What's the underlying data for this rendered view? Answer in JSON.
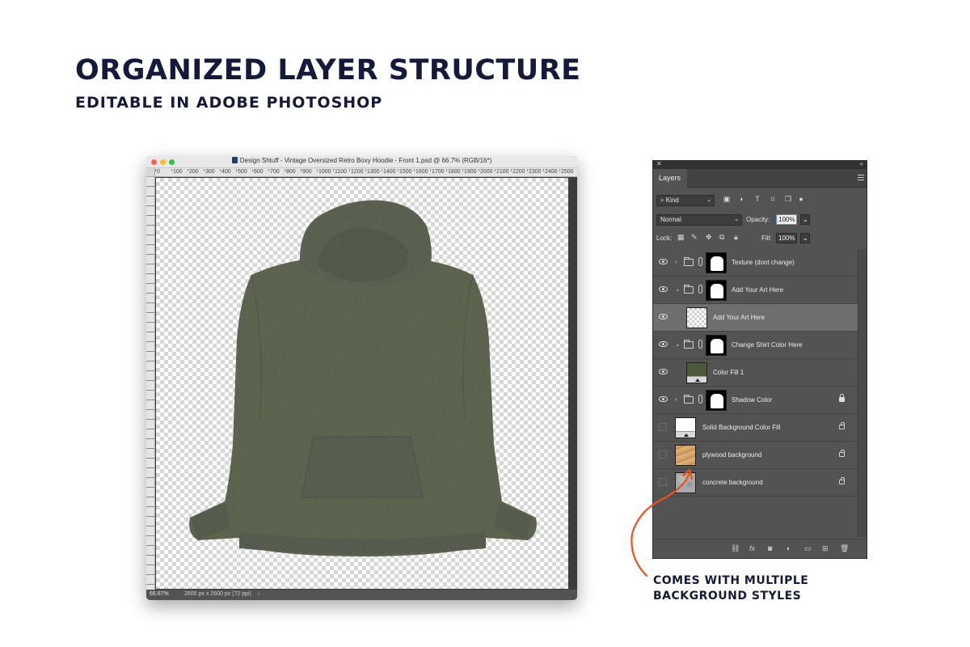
{
  "heading": {
    "title": "ORGANIZED LAYER STRUCTURE",
    "subtitle": "EDITABLE IN ADOBE PHOTOSHOP"
  },
  "document_window": {
    "title": "Design Shtuff - Vintage Oversized Retro Boxy Hoodie - Front 1.psd @ 66.7% (RGB/16*)",
    "ruler_labels": [
      "0",
      "100",
      "200",
      "300",
      "400",
      "500",
      "600",
      "700",
      "800",
      "900",
      "1000",
      "1100",
      "1200",
      "1300",
      "1400",
      "1500",
      "1600",
      "1700",
      "1800",
      "1900",
      "2000",
      "2100",
      "2200",
      "2300",
      "2400",
      "2500"
    ],
    "status_zoom": "66.67%",
    "status_dims": "2600 px x 2600 px (72 ppi)",
    "status_arrow": "›",
    "hoodie_color": "#4b5439"
  },
  "layers_panel": {
    "tab_label": "Layers",
    "filter_kind": "Kind",
    "blend_mode": "Normal",
    "opacity_label": "Opacity:",
    "opacity_value": "100%",
    "lock_label": "Lock:",
    "fill_label": "Fill:",
    "fill_value": "100%",
    "layers": [
      {
        "name": "Texture (dont change)",
        "type": "group",
        "visible": true,
        "expanded": false,
        "locked": false
      },
      {
        "name": "Add Your Art Here",
        "type": "group",
        "visible": true,
        "expanded": true,
        "locked": false
      },
      {
        "name": "Add Your Art Here",
        "type": "smart-object",
        "visible": true,
        "selected": true,
        "locked": false
      },
      {
        "name": "Change Shirt Color Here",
        "type": "group",
        "visible": true,
        "expanded": true,
        "locked": false
      },
      {
        "name": "Color Fill 1",
        "type": "fill",
        "visible": true,
        "locked": false
      },
      {
        "name": "Shadow Color",
        "type": "group",
        "visible": true,
        "expanded": false,
        "locked": true
      },
      {
        "name": "Solid Background Color Fill",
        "type": "fill",
        "visible": false,
        "locked": true
      },
      {
        "name": "plywood background",
        "type": "image",
        "visible": false,
        "locked": true
      },
      {
        "name": "concrete background",
        "type": "image",
        "visible": false,
        "locked": true
      }
    ],
    "bottom_icons": [
      "link-icon",
      "fx-icon",
      "mask-icon",
      "adjustment-icon",
      "folder-icon",
      "new-layer-icon",
      "trash-icon"
    ]
  },
  "callout": {
    "line1": "COMES WITH MULTIPLE",
    "line2": "BACKGROUND STYLES",
    "arrow_color": "#e8531c"
  }
}
